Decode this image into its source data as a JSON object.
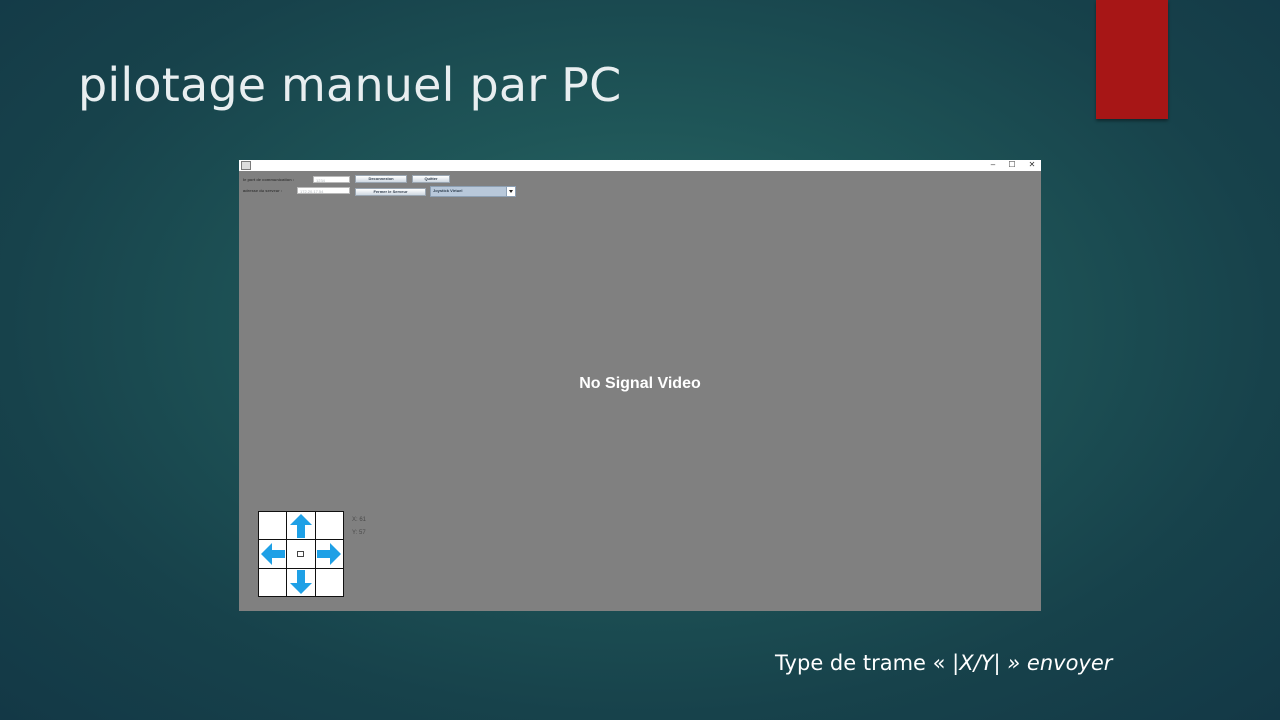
{
  "slide": {
    "title": "pilotage manuel par PC",
    "caption_prefix": "Type de trame « ",
    "caption_frame": "|X/Y| » envoyer",
    "accent_color": "#a71616"
  },
  "window": {
    "controls": {
      "minimize": "–",
      "maximize": "☐",
      "close": "✕"
    },
    "port_label": "le port de communication :",
    "port_value": "1234",
    "address_label": "adresse du serveur :",
    "address_value": "172.20.17.54",
    "disconnect_label": "Deconnexion",
    "quit_label": "Quitter",
    "close_server_label": "Fermer le Serveur",
    "mode_selected": "Joystick Virtuel",
    "video_status": "No Signal Video",
    "joystick": {
      "x_label": "X: 61",
      "y_label": "Y: 57",
      "arrow_color": "#1ea0e6",
      "icons": [
        "arrow-up-icon",
        "arrow-left-icon",
        "arrow-right-icon",
        "arrow-down-icon"
      ]
    }
  }
}
